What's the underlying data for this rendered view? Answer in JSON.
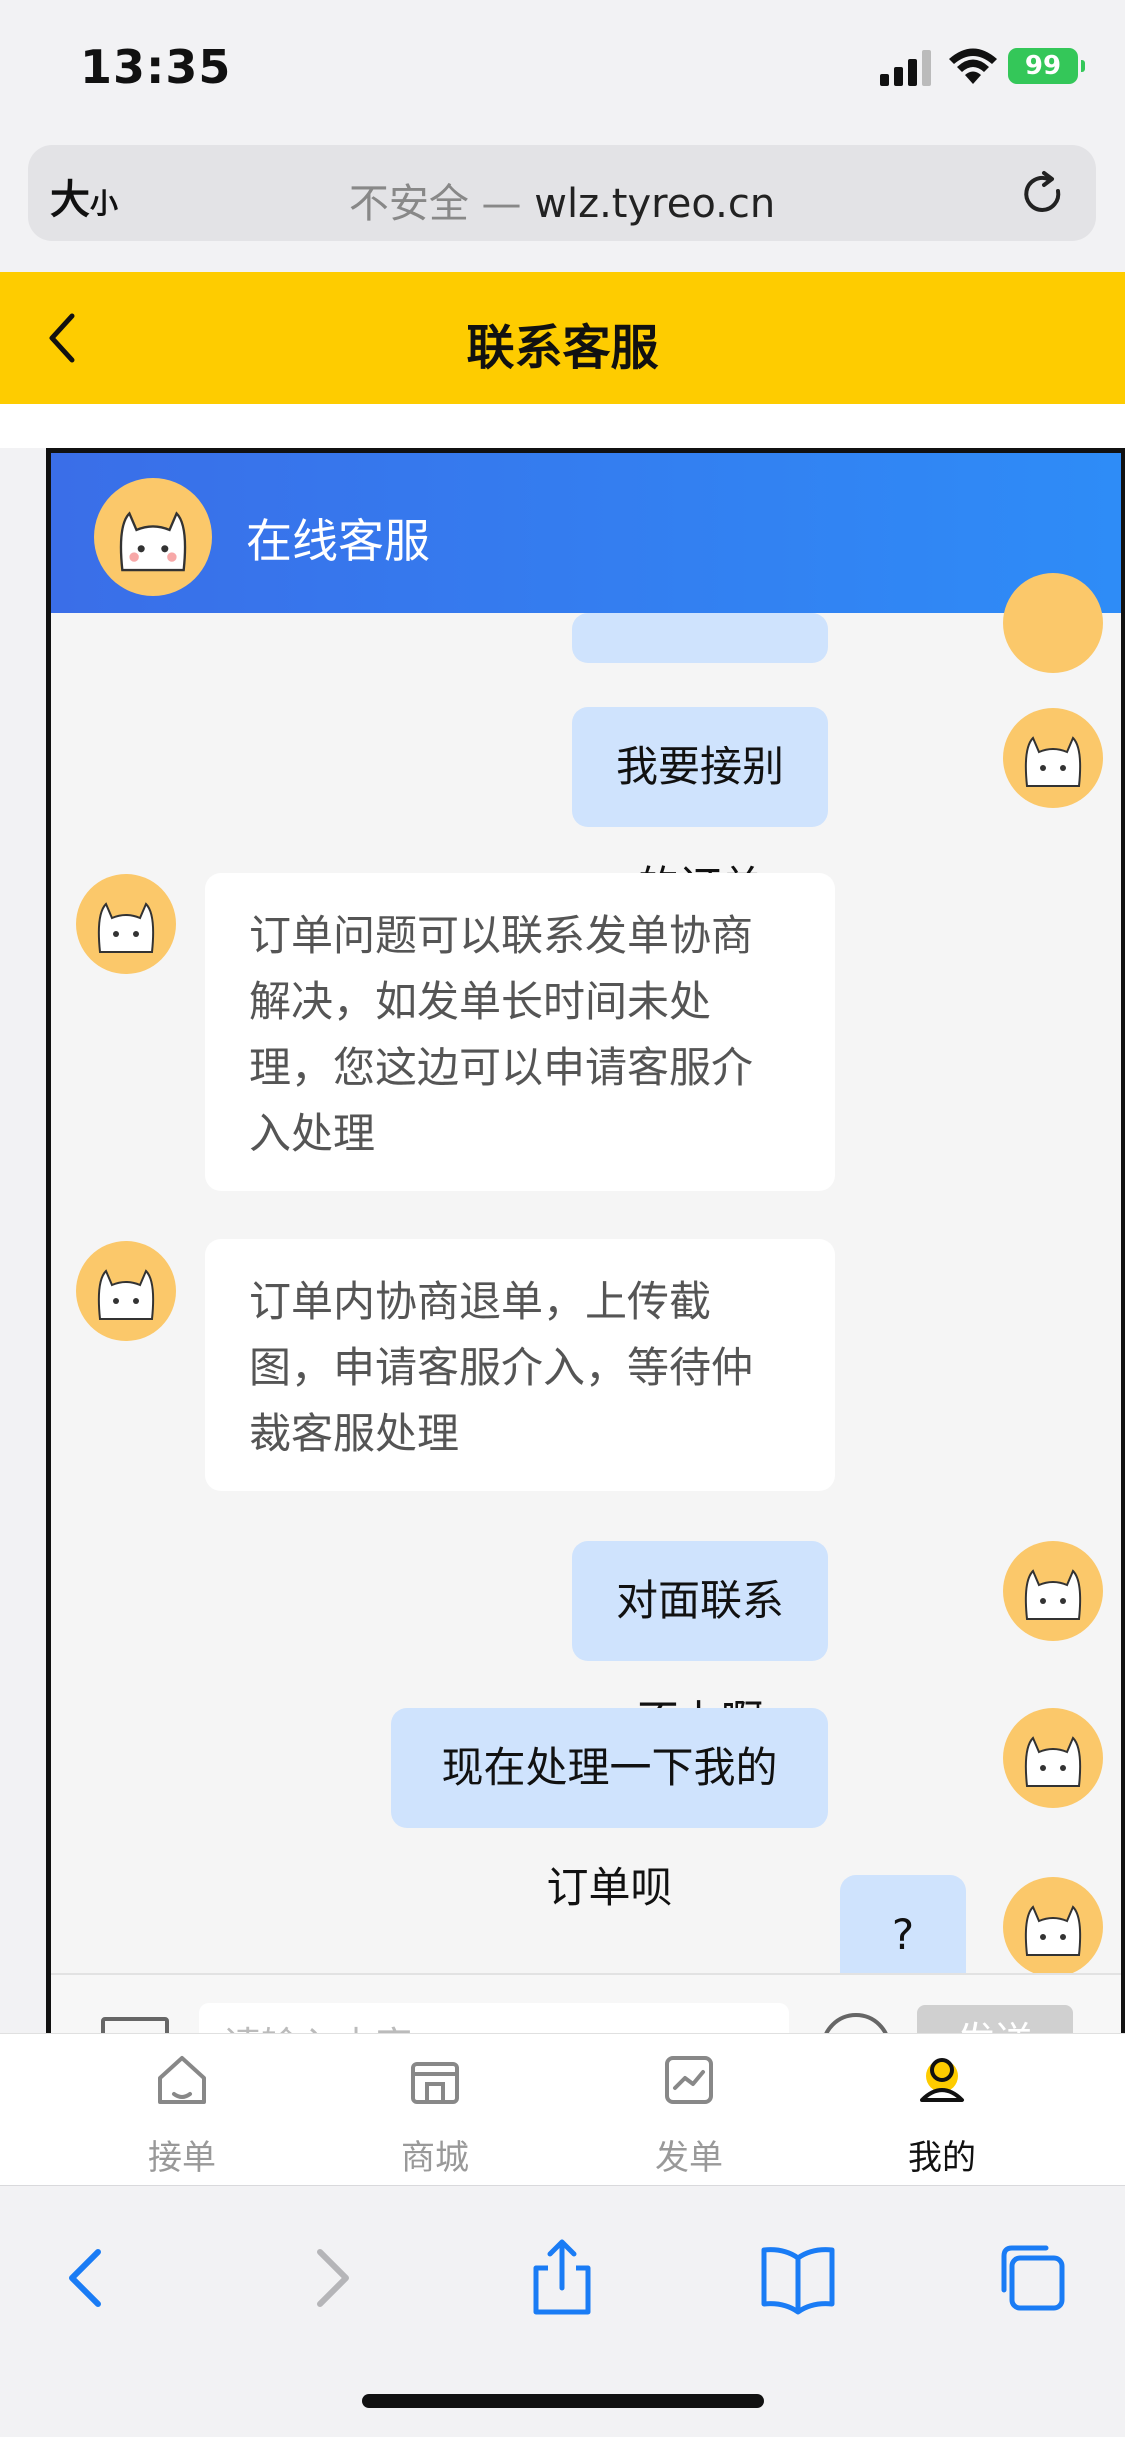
{
  "status": {
    "time": "13:35",
    "battery": "99"
  },
  "browser": {
    "text_size": "大",
    "text_size_small": "小",
    "insecure": "不安全 —",
    "domain": "wlz.tyreo.cn"
  },
  "nav": {
    "title": "联系客服"
  },
  "chat": {
    "header_title": "在线客服",
    "messages": [
      {
        "from": "me",
        "text": "我要接别的订单"
      },
      {
        "from": "bot",
        "text": "订单问题可以联系发单协商解决，如发单长时间未处理，您这边可以申请客服介入处理"
      },
      {
        "from": "bot",
        "text": "订单内协商退单，上传截图，申请客服介入，等待仲裁客服处理"
      },
      {
        "from": "me",
        "text": "对面联系不上啊"
      },
      {
        "from": "me",
        "text": "现在处理一下我的订单呗"
      },
      {
        "from": "me",
        "text": "?"
      }
    ],
    "input_placeholder": "请输入内容",
    "send_label": "发送"
  },
  "tabs": [
    {
      "label": "接单",
      "icon": "home-icon"
    },
    {
      "label": "商城",
      "icon": "shop-icon"
    },
    {
      "label": "发单",
      "icon": "publish-icon"
    },
    {
      "label": "我的",
      "icon": "profile-icon",
      "active": true
    }
  ],
  "colors": {
    "nav_yellow": "#fecc00",
    "chat_header_blue": "#2e7ff0",
    "user_bubble": "#cfe3fd",
    "avatar_orange": "#fbc86a",
    "safari_blue": "#1a7cf5"
  }
}
